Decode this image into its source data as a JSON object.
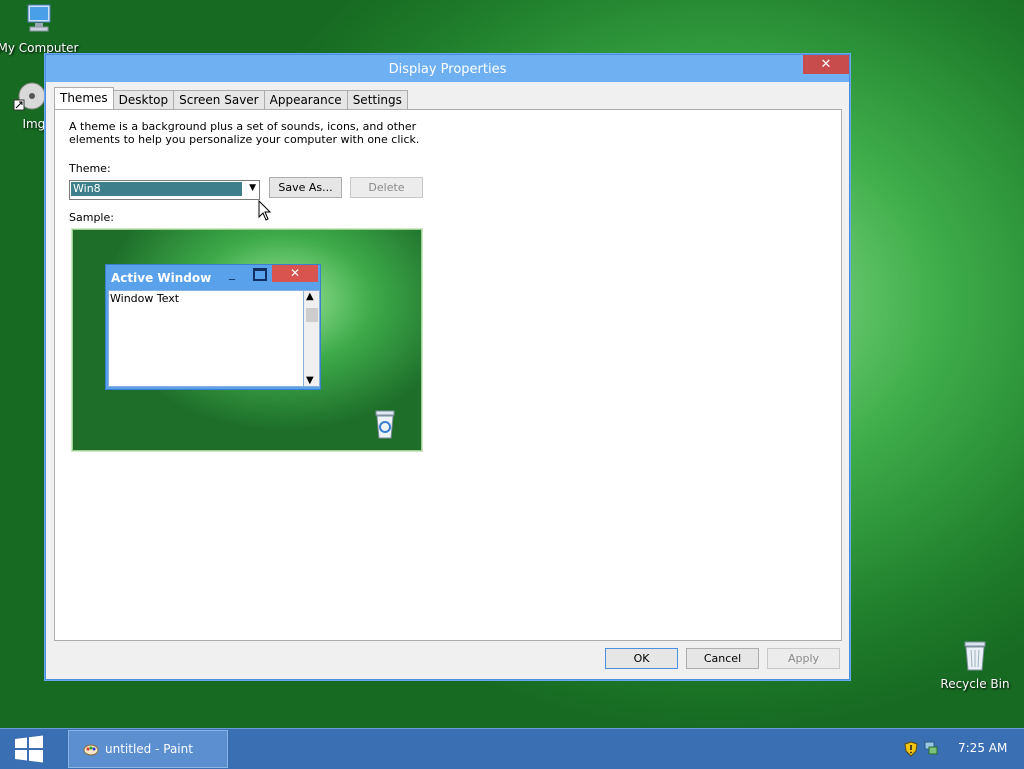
{
  "desktop": {
    "icons": [
      {
        "label": "My Computer"
      },
      {
        "label": "ImgB"
      },
      {
        "label": "Recycle Bin"
      }
    ]
  },
  "dialog": {
    "title": "Display Properties",
    "close_glyph": "✕",
    "tabs": [
      {
        "label": "Themes",
        "active": true
      },
      {
        "label": "Desktop",
        "active": false
      },
      {
        "label": "Screen Saver",
        "active": false
      },
      {
        "label": "Appearance",
        "active": false
      },
      {
        "label": "Settings",
        "active": false
      }
    ],
    "intro": "A theme is a background plus a set of sounds, icons, and other elements to help you personalize your computer with one click.",
    "theme_label": "Theme:",
    "theme_value": "Win8",
    "save_as_label": "Save As...",
    "delete_label": "Delete",
    "sample_label": "Sample:",
    "sample": {
      "window_title": "Active Window",
      "window_text": "Window Text"
    },
    "ok_label": "OK",
    "cancel_label": "Cancel",
    "apply_label": "Apply"
  },
  "taskbar": {
    "task_label": "untitled - Paint",
    "clock": "7:25 AM"
  },
  "colors": {
    "titlebar": "#6fb0f2",
    "close": "#c94c4c",
    "taskbar": "#3a6fb3",
    "selection": "#3d7f8a"
  }
}
